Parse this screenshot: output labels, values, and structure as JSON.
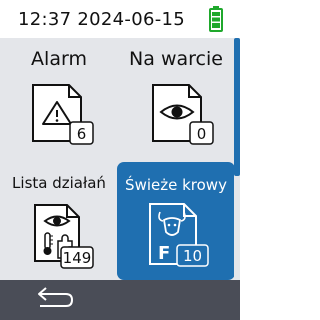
{
  "status": {
    "time": "12:37",
    "date": "2024-06-15",
    "battery_icon": "battery-full-icon",
    "battery_color": "#1fa82c"
  },
  "tiles": [
    {
      "label": "Alarm",
      "count": "6",
      "icon": "alarm-warning-icon"
    },
    {
      "label": "Na warcie",
      "count": "0",
      "icon": "watch-eye-icon"
    },
    {
      "label": "Lista działań",
      "count": "149",
      "icon": "action-list-icon"
    },
    {
      "label": "Świeże krowy",
      "count": "10",
      "icon": "fresh-cows-icon",
      "selected": true
    }
  ],
  "colors": {
    "accent": "#1f6fb0",
    "grid_background": "#e4e6ea",
    "bottom_bar": "#4a4d57"
  },
  "bottom": {
    "back_icon": "back-arrow-icon"
  }
}
